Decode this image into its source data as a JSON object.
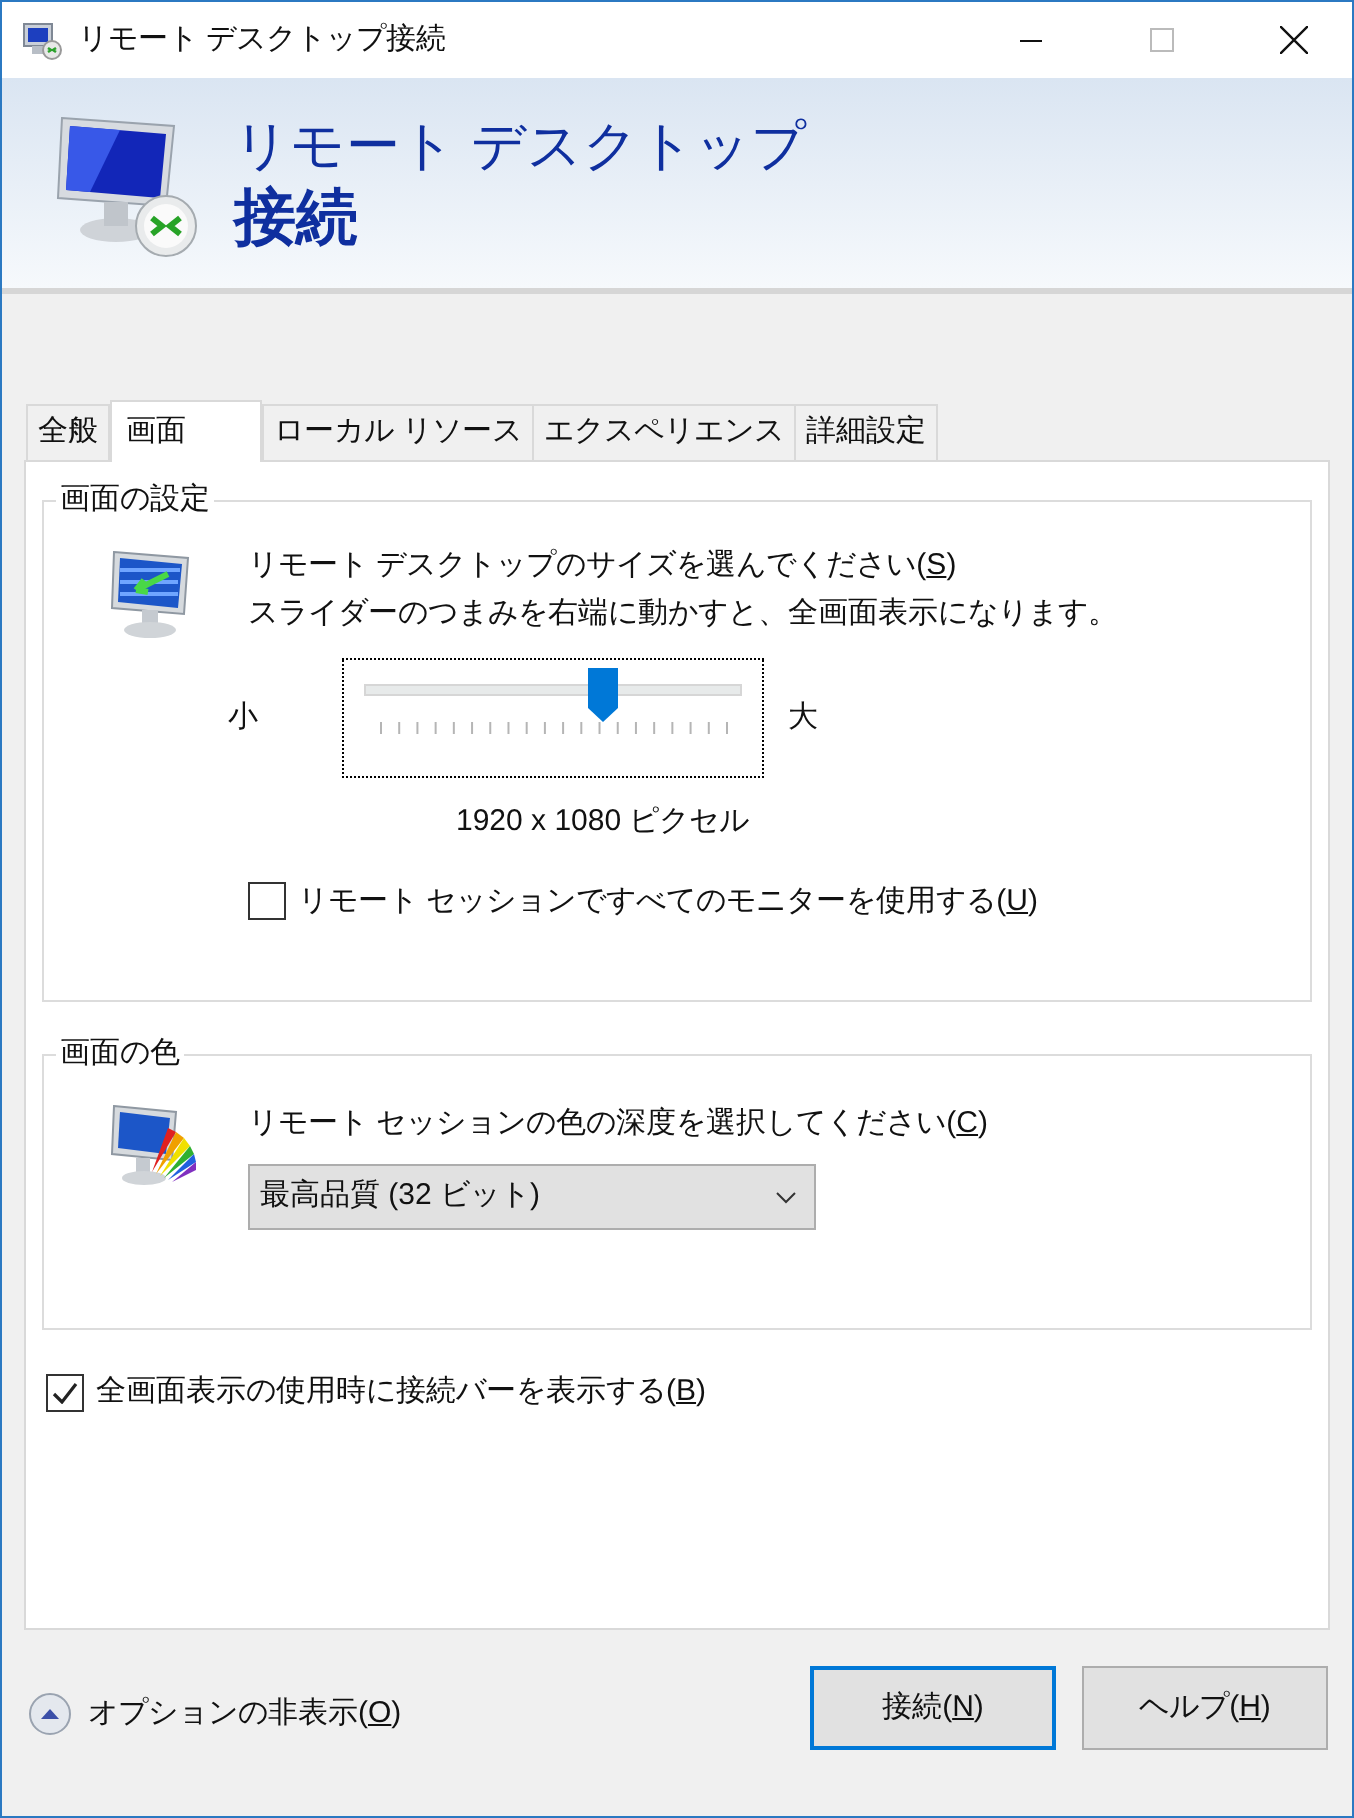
{
  "window": {
    "title": "リモート デスクトップ接続"
  },
  "header": {
    "line1": "リモート デスクトップ",
    "line2": "接続"
  },
  "tabs": [
    {
      "label": "全般",
      "selected": false
    },
    {
      "label": "画面",
      "selected": true
    },
    {
      "label": "ローカル リソース",
      "selected": false
    },
    {
      "label": "エクスペリエンス",
      "selected": false
    },
    {
      "label": "詳細設定",
      "selected": false
    }
  ],
  "display_settings": {
    "title": "画面の設定",
    "prompt": {
      "text": "リモート デスクトップのサイズを選んでください(",
      "key": "S",
      "after": ")"
    },
    "hint": "スライダーのつまみを右端に動かすと、全画面表示になります。",
    "small_label": "小",
    "large_label": "大",
    "level": 0.63,
    "resolution": "1920 x 1080 ピクセル",
    "all_monitors": {
      "text": "リモート セッションですべてのモニターを使用する(",
      "key": "U",
      "after": ")",
      "checked": false
    }
  },
  "colors": {
    "title": "画面の色",
    "prompt": {
      "text": "リモート セッションの色の深度を選択してください(",
      "key": "C",
      "after": ")"
    },
    "value": "最高品質 (32 ビット)"
  },
  "connection_bar": {
    "text": "全画面表示の使用時に接続バーを表示する(",
    "key": "B",
    "after": ")",
    "checked": true
  },
  "options_toggle": {
    "text": "オプションの非表示(",
    "key": "O",
    "after": ")"
  },
  "buttons": [
    {
      "text": "接続(",
      "key": "N",
      "after": ")",
      "default": true
    },
    {
      "text": "ヘルプ(",
      "key": "H",
      "after": ")",
      "default": false
    }
  ]
}
